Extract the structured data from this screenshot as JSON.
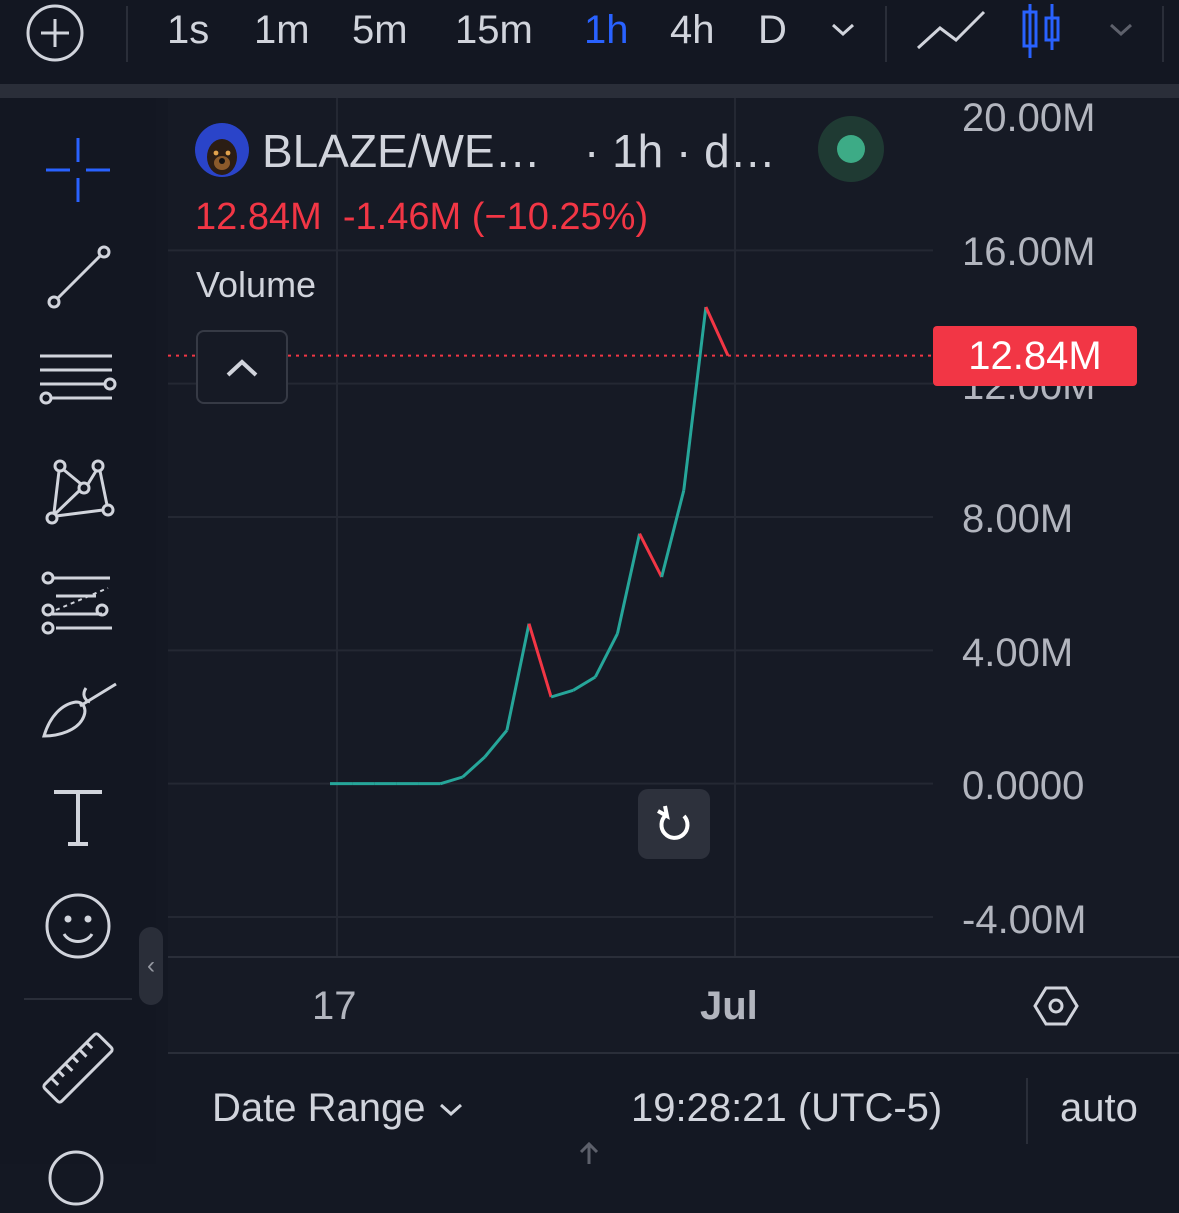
{
  "toolbar": {
    "intervals": [
      "1s",
      "1m",
      "5m",
      "15m",
      "1h",
      "4h",
      "D"
    ],
    "active_interval": "1h"
  },
  "legend": {
    "pair": "BLAZE/WE…",
    "interval_text": "· 1h · d…",
    "last": "12.84M",
    "change": "-1.46M",
    "change_pct": "(−10.25%)",
    "indicator": "Volume"
  },
  "price_scale": {
    "labels": [
      "20.00M",
      "16.00M",
      "12.00M",
      "8.00M",
      "4.00M",
      "0.0000",
      "-4.00M"
    ],
    "current_price_label": "12.84M"
  },
  "time_scale": {
    "labels": [
      "17",
      "Jul"
    ]
  },
  "bottom_bar": {
    "date_range": "Date Range",
    "clock": "19:28:21 (UTC-5)",
    "scale_mode": "auto"
  },
  "colors": {
    "up": "#26a69a",
    "down": "#f23645",
    "accent": "#2962ff",
    "background": "#161a25"
  },
  "chart_data": {
    "type": "line",
    "title": "BLAZE/WE… · 1h",
    "xlabel": "",
    "ylabel": "",
    "ylim": [
      -4000000,
      20000000
    ],
    "x": [
      "17",
      "",
      "",
      "",
      "",
      "",
      "",
      "",
      "",
      "",
      "",
      "",
      "",
      "",
      "",
      "",
      "",
      "",
      "",
      "Jul"
    ],
    "series": [
      {
        "name": "",
        "values": [
          0,
          0,
          0,
          0,
          0,
          0,
          200000,
          800000,
          1600000,
          4800000,
          2600000,
          2800000,
          3200000,
          4500000,
          7500000,
          6200000,
          8800000,
          14300000,
          12840000
        ]
      }
    ]
  }
}
